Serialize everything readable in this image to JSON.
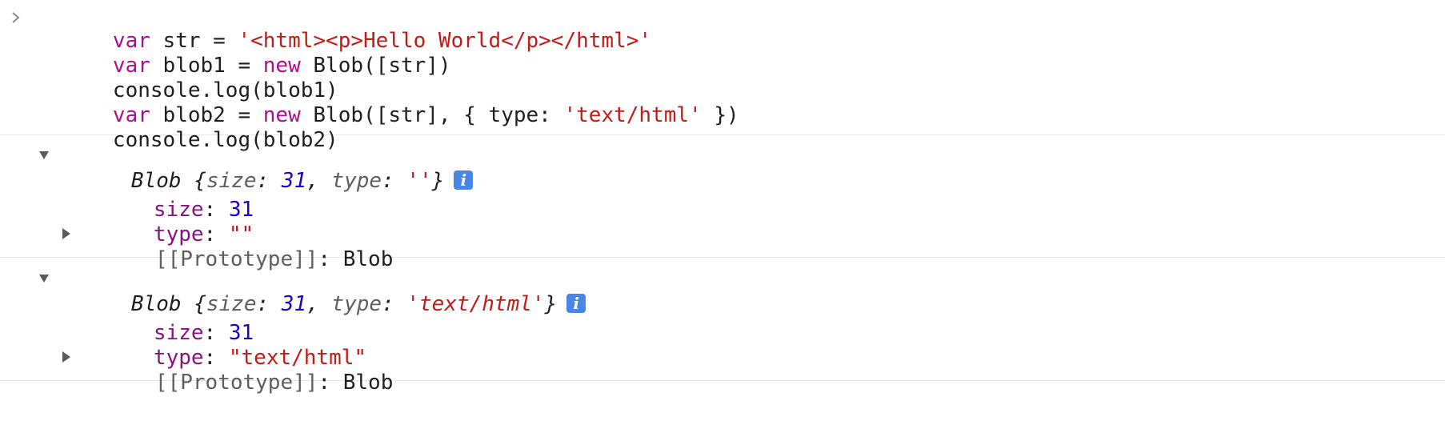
{
  "input": {
    "lines": [
      [
        {
          "t": "var",
          "c": "kw"
        },
        {
          "t": " str = ",
          "c": "plain"
        },
        {
          "t": "'<html><p>Hello World</p></html>'",
          "c": "str"
        }
      ],
      [
        {
          "t": "var",
          "c": "kw"
        },
        {
          "t": " blob1 = ",
          "c": "plain"
        },
        {
          "t": "new",
          "c": "kw"
        },
        {
          "t": " Blob([str])",
          "c": "plain"
        }
      ],
      [
        {
          "t": "console.log(blob1)",
          "c": "plain"
        }
      ],
      [
        {
          "t": "var",
          "c": "kw"
        },
        {
          "t": " blob2 = ",
          "c": "plain"
        },
        {
          "t": "new",
          "c": "kw"
        },
        {
          "t": " Blob([str], { type: ",
          "c": "plain"
        },
        {
          "t": "'text/html'",
          "c": "str"
        },
        {
          "t": " })",
          "c": "plain"
        }
      ],
      [
        {
          "t": "console.log(blob2)",
          "c": "plain"
        }
      ]
    ]
  },
  "outputs": [
    {
      "summary": {
        "name": "Blob",
        "open": " {",
        "size_key": "size",
        "colon1": ": ",
        "size_val": "31",
        "sep": ", ",
        "type_key": "type",
        "colon2": ": ",
        "type_val": "''",
        "close": "}"
      },
      "props": [
        {
          "key": "size",
          "val": "31",
          "val_kind": "num"
        },
        {
          "key": "type",
          "val": "\"\"",
          "val_kind": "str"
        }
      ],
      "prototype": {
        "key": "[[Prototype]]",
        "sep": ": ",
        "val": "Blob"
      }
    },
    {
      "summary": {
        "name": "Blob",
        "open": " {",
        "size_key": "size",
        "colon1": ": ",
        "size_val": "31",
        "sep": ", ",
        "type_key": "type",
        "colon2": ": ",
        "type_val": "'text/html'",
        "close": "}"
      },
      "props": [
        {
          "key": "size",
          "val": "31",
          "val_kind": "num"
        },
        {
          "key": "type",
          "val": "\"text/html\"",
          "val_kind": "str"
        }
      ],
      "prototype": {
        "key": "[[Prototype]]",
        "sep": ": ",
        "val": "Blob"
      }
    }
  ],
  "icons": {
    "prompt": "chevron-right-icon",
    "expand_open": "triangle-down-icon",
    "expand_closed": "triangle-right-icon",
    "info": "info-icon"
  },
  "info_glyph": "i",
  "colors": {
    "keyword": "#aa0d91",
    "string": "#c41a16",
    "number": "#1c00cf",
    "property": "#881280",
    "info_badge": "#4a86e8"
  }
}
